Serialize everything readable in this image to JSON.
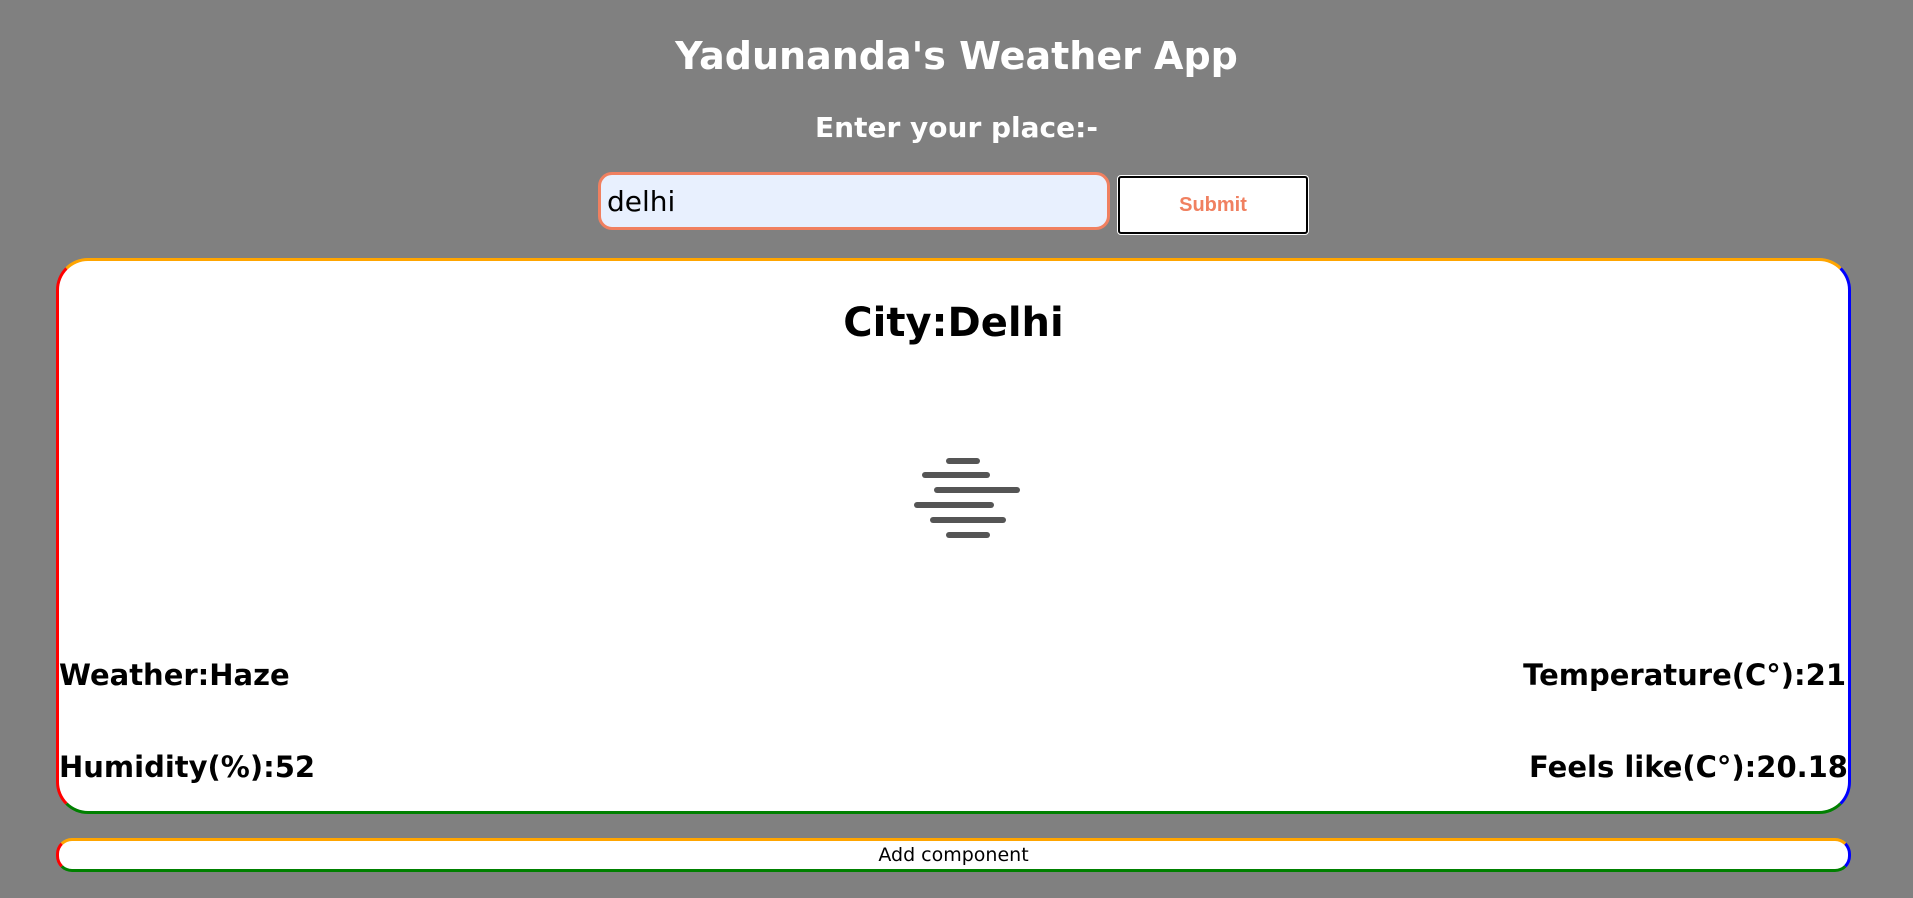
{
  "app": {
    "title": "Yadunanda's Weather App"
  },
  "search": {
    "prompt": "Enter your place:-",
    "input_value": "delhi",
    "submit_label": "Submit"
  },
  "result": {
    "city_text": "City:Delhi",
    "weather_icon": "haze-icon",
    "weather_text": "Weather:Haze",
    "temperature_text": "Temperature(C°):21",
    "humidity_text": "Humidity(%):52",
    "feels_like_text": "Feels like(C°):20.18"
  },
  "footer": {
    "add_component_label": "Add component"
  },
  "colors": {
    "background": "#808080",
    "accent": "#f08060",
    "card_border_top": "#ffa500",
    "card_border_right": "#0000ff",
    "card_border_bottom": "#008000",
    "card_border_left": "#ff0000"
  }
}
